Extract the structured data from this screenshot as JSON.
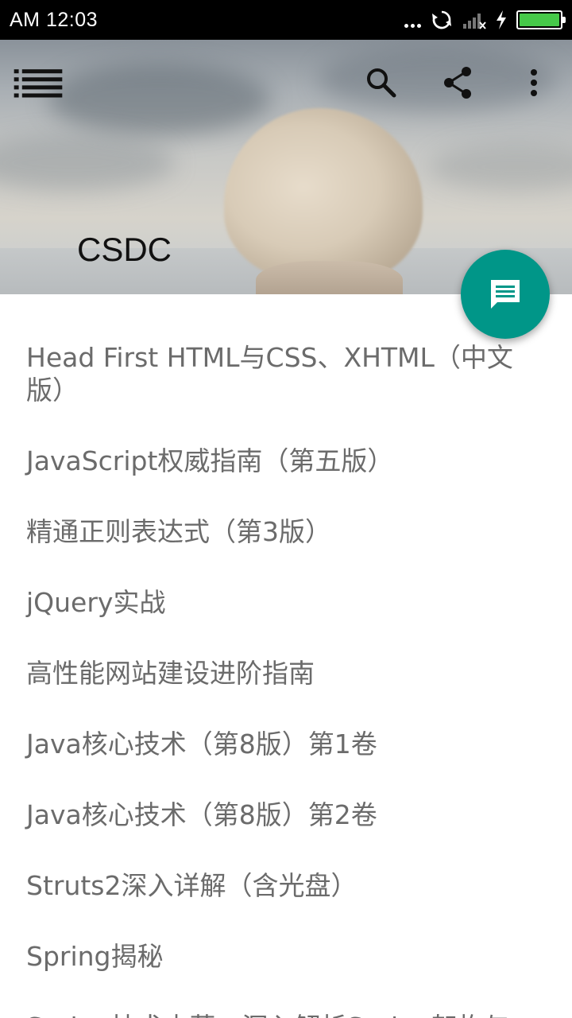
{
  "status_bar": {
    "time": "AM 12:03",
    "battery_color": "#46c949",
    "icons": [
      "more-dots-icon",
      "sync-icon",
      "signal-icon",
      "charging-icon",
      "battery-icon"
    ]
  },
  "toolbar": {
    "title": "CSDC",
    "menu_icon": "list-menu-icon",
    "search_icon": "search-icon",
    "share_icon": "share-icon",
    "overflow_icon": "more-vert-icon"
  },
  "fab": {
    "icon": "message-icon",
    "color": "#009688"
  },
  "books": [
    "Head First HTML与CSS、XHTML（中文版）",
    "JavaScript权威指南（第五版）",
    "精通正则表达式（第3版）",
    "jQuery实战",
    "高性能网站建设进阶指南",
    "Java核心技术（第8版）第1卷",
    "Java核心技术（第8版）第2卷",
    "Struts2深入详解（含光盘）",
    "Spring揭秘",
    "Spring技术内幕：深入解析Spring架构与"
  ]
}
